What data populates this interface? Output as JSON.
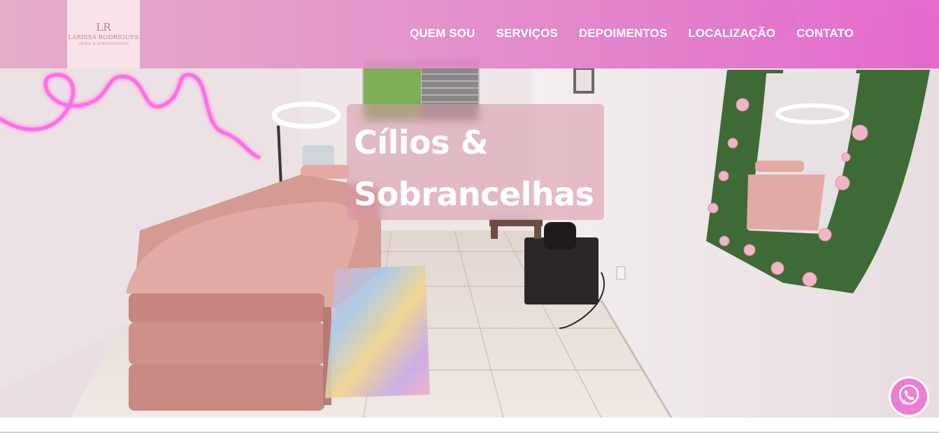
{
  "logo": {
    "mark": "LR",
    "name": "LARISSA RODRIGUES",
    "subtitle": "CÍLIOS & SOBRANCELHAS"
  },
  "nav": {
    "items": [
      {
        "label": "QUEM SOU"
      },
      {
        "label": "SERVIÇOS"
      },
      {
        "label": "DEPOIMENTOS"
      },
      {
        "label": "LOCALIZAÇÃO"
      },
      {
        "label": "CONTATO"
      }
    ]
  },
  "hero": {
    "headline_line1": "Cílios &",
    "headline_line2": "Sobrancelhas"
  },
  "colors": {
    "header_start": "#e4aac8",
    "header_end": "#e464cc",
    "logo_bg": "#fbe3ea",
    "accent_pink": "#ec7fd2",
    "neon": "#ff6ee6"
  },
  "icons": {
    "whatsapp": "whatsapp-icon"
  }
}
